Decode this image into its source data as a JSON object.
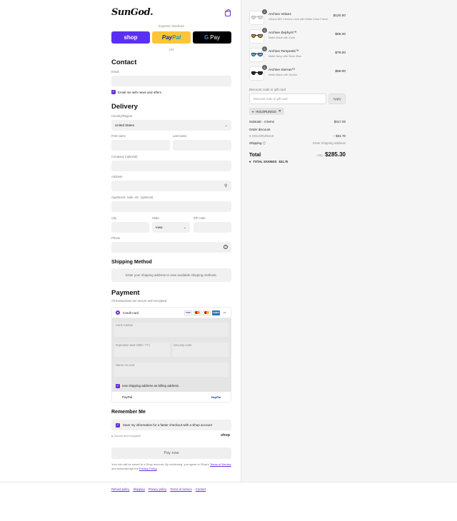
{
  "brand": {
    "logo_text": "SunGod."
  },
  "express": {
    "label": "Express checkout",
    "shop_label": "shop",
    "paypal_label_a": "Pay",
    "paypal_label_b": "Pal",
    "gpay_g": "G",
    "gpay_label": "Pay",
    "or_label": "OR"
  },
  "contact": {
    "heading": "Contact",
    "email_label": "Email",
    "newsletter_label": "Email me with news and offers"
  },
  "delivery": {
    "heading": "Delivery",
    "country_label": "Country/Region",
    "country_value": "United States",
    "first_name_label": "First name",
    "last_name_label": "Last name",
    "company_label": "Company (optional)",
    "address_label": "Address",
    "apartment_label": "Apartment, suite, etc. (optional)",
    "city_label": "City",
    "state_label": "State",
    "state_value": "Iowa",
    "zip_label": "ZIP code",
    "phone_label": "Phone"
  },
  "shipping_method": {
    "heading": "Shipping Method",
    "message": "Enter your shipping address to view available shipping methods."
  },
  "payment": {
    "heading": "Payment",
    "subtitle": "All transactions are secure and encrypted.",
    "credit_card_label": "Credit card",
    "card_icons": [
      "VISA",
      "MC",
      "MAE",
      "AMEX",
      "+4"
    ],
    "card_number_label": "Card number",
    "expiration_label": "Expiration date (MM / YY)",
    "security_label": "Security code",
    "name_label": "Name on card",
    "billing_label": "Use shipping address as billing address",
    "paypal_label": "PayPal",
    "paypal_logo": "PayPal"
  },
  "remember": {
    "heading": "Remember Me",
    "save_label": "Save my information for a faster checkout with a Shop account",
    "secure_label": "Secure and encrypted",
    "shop_logo": "shop"
  },
  "pay_now_label": "Pay now",
  "terms": {
    "text_a": "Your info will be saved to a Shop account. By continuing, you agree to Shop's ",
    "tos_link": "Terms of Service",
    "text_b": " and acknowledge the ",
    "privacy_link": "Privacy Policy",
    "text_c": "."
  },
  "footer": {
    "links": [
      "Refund policy",
      "Shipping",
      "Privacy policy",
      "Terms of service",
      "Contact"
    ]
  },
  "cart": {
    "items": [
      {
        "name": "Archive Velans",
        "variant": "Velans BIO Chrome Lens with Matte Clear Frame",
        "price": "$120.00",
        "qty": "1",
        "lens_color": "#d8d8d8",
        "frame_color": "#bbbbbb"
      },
      {
        "name": "Archive Zephyrs™",
        "variant": "Matte Black with Gold",
        "price": "$59.00",
        "qty": "1",
        "lens_color": "#c9872e",
        "frame_color": "#333333"
      },
      {
        "name": "Archive Tempests™",
        "variant": "Matte Navy with Silver Blue",
        "price": "$79.00",
        "qty": "1",
        "lens_color": "#58b6e8",
        "frame_color": "#1f2d4d"
      },
      {
        "name": "Archive Sierras™",
        "variant": "Matte Black with Smoke",
        "price": "$59.00",
        "qty": "1",
        "lens_color": "#2b2b2b",
        "frame_color": "#111111"
      }
    ],
    "discount_label": "Discount code or gift card",
    "discount_placeholder": "Discount code or gift card",
    "apply_label": "Apply",
    "applied_code": "HOLORUNS10",
    "subtotal_label": "Subtotal · 4 items",
    "subtotal_value": "$317.00",
    "order_discount_label": "Order discount",
    "discount_code": "HOLORUNS10",
    "discount_value": "– $31.70",
    "shipping_label": "Shipping",
    "shipping_value": "Enter shipping address",
    "total_label": "Total",
    "currency": "USD",
    "total_value": "$285.30",
    "savings_label": "TOTAL SAVINGS",
    "savings_value": "$31.70"
  },
  "colors": {
    "accent": "#6b2bd9",
    "shop": "#5a31f4",
    "paypal": "#ffc439"
  }
}
